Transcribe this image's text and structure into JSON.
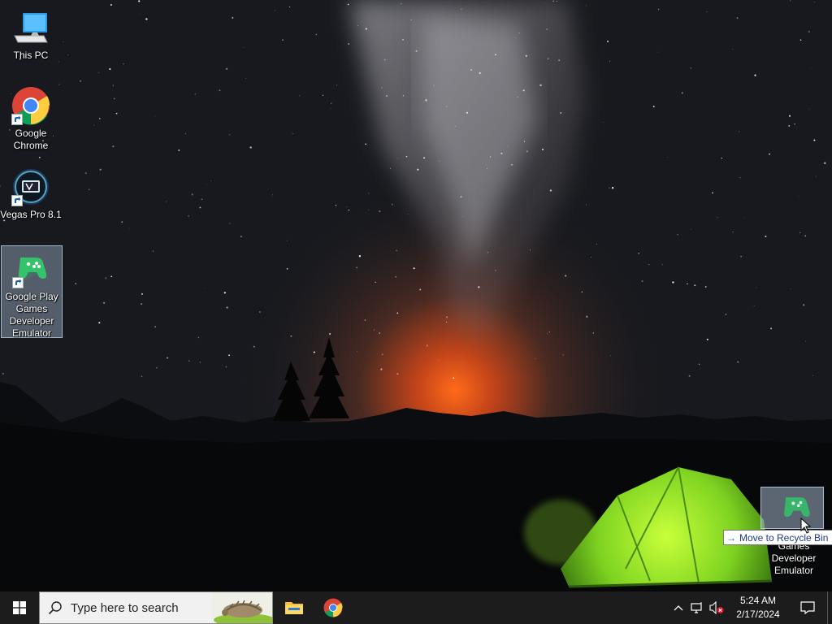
{
  "desktop": {
    "icons": [
      {
        "label": "This PC",
        "icon": "this-pc-icon"
      },
      {
        "label": "Google Chrome",
        "icon": "chrome-icon"
      },
      {
        "label": "Vegas Pro 8.1",
        "icon": "vegas-pro-icon"
      },
      {
        "label": "Google Play Games Developer Emulator",
        "icon": "google-play-games-icon"
      }
    ],
    "drag_ghost": {
      "label": "Games Developer Emulator",
      "icon": "google-play-games-icon"
    },
    "tooltip": {
      "text": "Move to Recycle Bin",
      "icon": "arrow-right-icon"
    }
  },
  "taskbar": {
    "start_icon": "windows-logo-icon",
    "search": {
      "placeholder": "Type here to search",
      "icon": "search-icon"
    },
    "pinned": [
      {
        "name": "File Explorer",
        "icon": "file-explorer-icon"
      },
      {
        "name": "Google Chrome",
        "icon": "chrome-icon"
      }
    ],
    "tray": {
      "icons": [
        "chevron-up-icon",
        "network-icon",
        "volume-muted-icon"
      ],
      "time": "5:24 AM",
      "date": "2/17/2024"
    },
    "notification_icon": "action-center-icon"
  },
  "colors": {
    "taskbar_bg": "#1c1c1c",
    "search_bg": "#f1f1f1",
    "tent_green": "#7ed321",
    "horizon_orange": "#e0601a",
    "selection": "#a0b4c8"
  }
}
